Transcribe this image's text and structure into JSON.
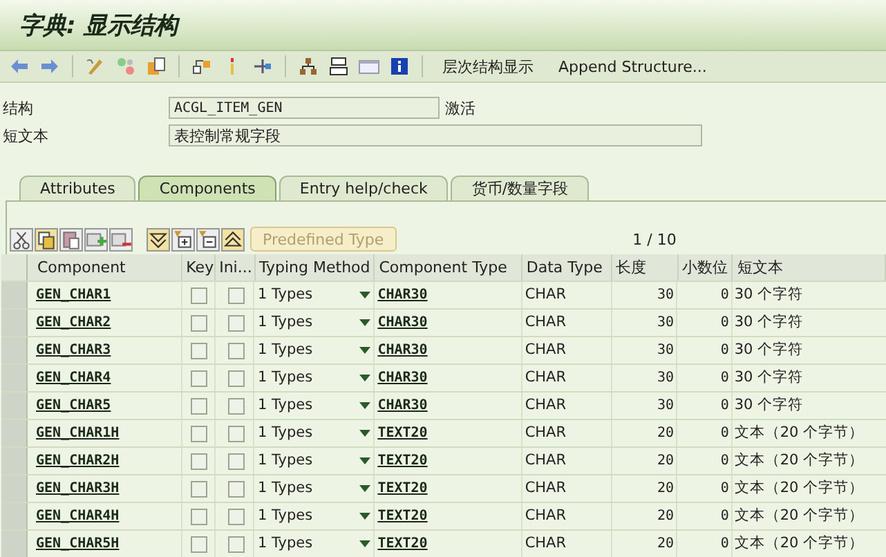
{
  "window": {
    "title": "字典: 显示结构"
  },
  "toolbar": {
    "buttons": [
      "层次结构显示",
      "Append Structure..."
    ]
  },
  "fields": [
    {
      "label": "结构",
      "value": "ACGL_ITEM_GEN",
      "status": "激活"
    },
    {
      "label": "短文本",
      "value": "表控制常规字段"
    }
  ],
  "tabs": [
    {
      "label": "Attributes",
      "selected": false
    },
    {
      "label": "Components",
      "selected": true
    },
    {
      "label": "Entry help/check",
      "selected": false
    },
    {
      "label": "货币/数量字段",
      "selected": false
    }
  ],
  "table": {
    "predefined_button": {
      "label": "Predefined Type",
      "disabled": true
    },
    "pager": "1 / 10",
    "columns": [
      "Component",
      "Key",
      "Ini...",
      "Typing Method",
      "Component Type",
      "Data Type",
      "长度",
      "小数位",
      "短文本"
    ],
    "rows": [
      {
        "component": "GEN_CHAR1",
        "key": false,
        "initial": false,
        "typing": "1 Types",
        "type": "CHAR30",
        "data_type": "CHAR",
        "length": "30",
        "decimals": "0",
        "text": "30 个字符"
      },
      {
        "component": "GEN_CHAR2",
        "key": false,
        "initial": false,
        "typing": "1 Types",
        "type": "CHAR30",
        "data_type": "CHAR",
        "length": "30",
        "decimals": "0",
        "text": "30 个字符"
      },
      {
        "component": "GEN_CHAR3",
        "key": false,
        "initial": false,
        "typing": "1 Types",
        "type": "CHAR30",
        "data_type": "CHAR",
        "length": "30",
        "decimals": "0",
        "text": "30 个字符"
      },
      {
        "component": "GEN_CHAR4",
        "key": false,
        "initial": false,
        "typing": "1 Types",
        "type": "CHAR30",
        "data_type": "CHAR",
        "length": "30",
        "decimals": "0",
        "text": "30 个字符"
      },
      {
        "component": "GEN_CHAR5",
        "key": false,
        "initial": false,
        "typing": "1 Types",
        "type": "CHAR30",
        "data_type": "CHAR",
        "length": "30",
        "decimals": "0",
        "text": "30 个字符"
      },
      {
        "component": "GEN_CHAR1H",
        "key": false,
        "initial": false,
        "typing": "1 Types",
        "type": "TEXT20",
        "data_type": "CHAR",
        "length": "20",
        "decimals": "0",
        "text": "文本（20 个字节）"
      },
      {
        "component": "GEN_CHAR2H",
        "key": false,
        "initial": false,
        "typing": "1 Types",
        "type": "TEXT20",
        "data_type": "CHAR",
        "length": "20",
        "decimals": "0",
        "text": "文本（20 个字节）"
      },
      {
        "component": "GEN_CHAR3H",
        "key": false,
        "initial": false,
        "typing": "1 Types",
        "type": "TEXT20",
        "data_type": "CHAR",
        "length": "20",
        "decimals": "0",
        "text": "文本（20 个字节）"
      },
      {
        "component": "GEN_CHAR4H",
        "key": false,
        "initial": false,
        "typing": "1 Types",
        "type": "TEXT20",
        "data_type": "CHAR",
        "length": "20",
        "decimals": "0",
        "text": "文本（20 个字节）"
      },
      {
        "component": "GEN_CHAR5H",
        "key": false,
        "initial": false,
        "typing": "1 Types",
        "type": "TEXT20",
        "data_type": "CHAR",
        "length": "20",
        "decimals": "0",
        "text": "文本（20 个字节）"
      }
    ]
  }
}
